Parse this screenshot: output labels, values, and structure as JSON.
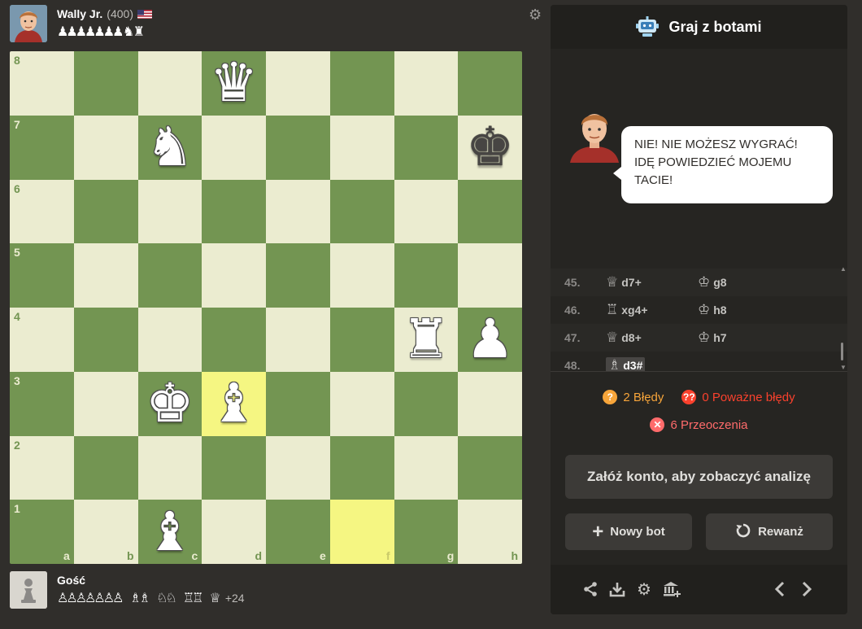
{
  "opponent": {
    "name": "Wally Jr.",
    "rating": "(400)",
    "flag": "us-flag",
    "captured": "♟♟♟♟♟♟♟ ♞ ♜"
  },
  "player": {
    "name": "Gość",
    "captured_pawns": "♙♙♙♙♙♙♙",
    "captured_bishops": "♗♗",
    "captured_knights": "♘♘",
    "captured_rooks": "♖♖",
    "captured_queen": "♕",
    "advantage": "+24"
  },
  "board": {
    "files": [
      "a",
      "b",
      "c",
      "d",
      "e",
      "f",
      "g",
      "h"
    ],
    "ranks": [
      "8",
      "7",
      "6",
      "5",
      "4",
      "3",
      "2",
      "1"
    ],
    "pieces": {
      "d8": "♕w",
      "c7": "♘w",
      "h7": "♚b",
      "g4": "♖w",
      "h4": "♙w",
      "c3": "♔w",
      "d3": "♗w",
      "c1": "♗w"
    },
    "highlights": [
      "d3",
      "f1"
    ]
  },
  "panel": {
    "title": "Graj z botami",
    "chat_message": "NIE! NIE MOŻESZ WYGRAĆ! IDĘ POWIEDZIEĆ MOJEMU TACIE!",
    "moves": [
      {
        "num": "45.",
        "white_fig": "♕",
        "white": "d7+",
        "black_fig": "♔",
        "black": "g8"
      },
      {
        "num": "46.",
        "white_fig": "♖",
        "white": "xg4+",
        "black_fig": "♔",
        "black": "h8"
      },
      {
        "num": "47.",
        "white_fig": "♕",
        "white": "d8+",
        "black_fig": "♔",
        "black": "h7"
      },
      {
        "num": "48.",
        "white_fig": "♗",
        "white": "d3#",
        "black_fig": "",
        "black": ""
      }
    ],
    "stats": {
      "mistakes": "2 Błędy",
      "blunders": "0 Poważne błędy",
      "misses": "6 Przeoczenia"
    },
    "analysis_button": "Załóż konto, aby zobaczyć analizę",
    "new_bot_button": "Nowy bot",
    "rematch_button": "Rewanż"
  },
  "colors": {
    "light_square": "#ebecd0",
    "dark_square": "#739552",
    "highlight": "#f5f682",
    "mistake": "#f7a53a",
    "blunder": "#fa412d"
  }
}
